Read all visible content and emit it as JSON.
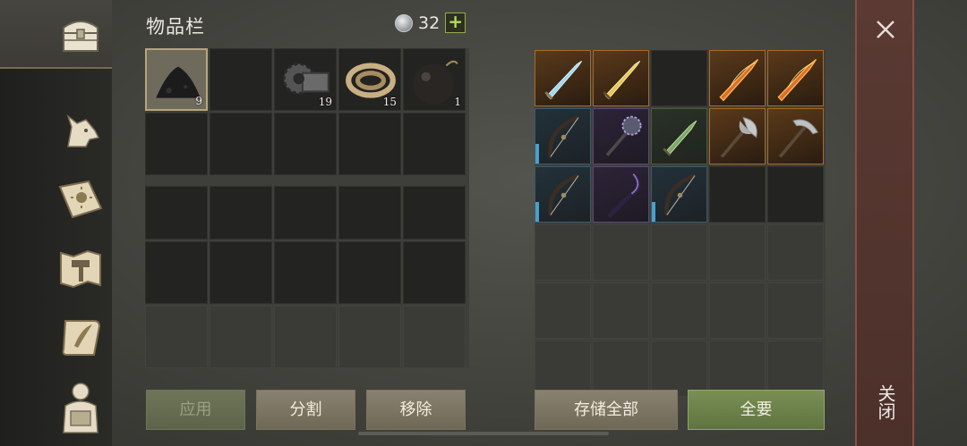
{
  "header": {
    "title": "物品栏",
    "currency_value": "32",
    "add_label": "+"
  },
  "nav": {
    "items": [
      {
        "name": "inventory-chest",
        "active": true
      },
      {
        "name": "wolf-pet"
      },
      {
        "name": "journal-sun"
      },
      {
        "name": "crafting-hammer"
      },
      {
        "name": "scroll-quill"
      },
      {
        "name": "character-backpack"
      }
    ]
  },
  "inventory": {
    "items": [
      {
        "slot": 0,
        "name": "charcoal",
        "qty": "9"
      },
      {
        "slot": 2,
        "name": "metal-gear",
        "qty": "19"
      },
      {
        "slot": 3,
        "name": "rope",
        "qty": "15"
      },
      {
        "slot": 4,
        "name": "bomb",
        "qty": "1"
      }
    ]
  },
  "storage": {
    "items": [
      {
        "slot": 0,
        "name": "ice-sword",
        "rarity": "orange"
      },
      {
        "slot": 1,
        "name": "golden-sword",
        "rarity": "orange"
      },
      {
        "slot": 3,
        "name": "fire-sword",
        "rarity": "orange"
      },
      {
        "slot": 4,
        "name": "fire-sword",
        "rarity": "orange"
      },
      {
        "slot": 5,
        "name": "recurve-bow",
        "rarity": "blue"
      },
      {
        "slot": 6,
        "name": "spiked-mace",
        "rarity": "purple"
      },
      {
        "slot": 7,
        "name": "green-dagger",
        "rarity": "green"
      },
      {
        "slot": 8,
        "name": "battle-axe",
        "rarity": "orange"
      },
      {
        "slot": 9,
        "name": "pickaxe",
        "rarity": "orange"
      },
      {
        "slot": 10,
        "name": "recurve-bow",
        "rarity": "blue"
      },
      {
        "slot": 11,
        "name": "scythe-bow",
        "rarity": "purple"
      },
      {
        "slot": 12,
        "name": "recurve-bow",
        "rarity": "blue"
      }
    ]
  },
  "buttons": {
    "apply": "应用",
    "split": "分割",
    "remove": "移除",
    "store_all": "存储全部",
    "take_all": "全要"
  },
  "close": {
    "label": "关闭"
  },
  "colors": {
    "orange": "#a86a28",
    "blue": "#3c5a6c",
    "purple": "#5a4a72",
    "green": "#4a5a40",
    "accent_green": "#8fae4a"
  }
}
